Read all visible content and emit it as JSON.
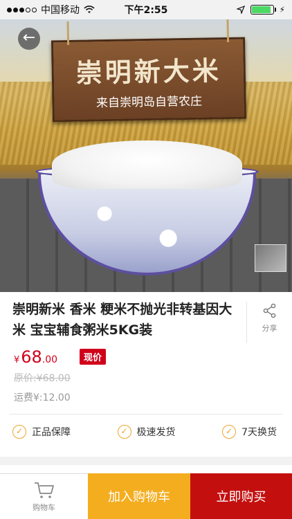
{
  "status_bar": {
    "carrier": "中国移动",
    "time": "下午2:55",
    "battery_level": 0.9,
    "icons": [
      "signal-dots-icon",
      "wifi-icon",
      "location-arrow-icon",
      "battery-icon",
      "charging-icon"
    ]
  },
  "hero": {
    "sign_title": "崇明新大米",
    "sign_subtitle": "来自崇明岛自营农庄"
  },
  "product": {
    "title": "崇明新米 香米 粳米不抛光非转基因大米 宝宝辅食粥米5KG装",
    "price_symbol": "¥",
    "price_int": "68",
    "price_dec": ".00",
    "now_badge": "现价",
    "original_price": "原价:¥68.00",
    "shipping": "运费¥:12.00",
    "share_label": "分享"
  },
  "guarantees": [
    "正品保障",
    "极速发货",
    "7天换货"
  ],
  "bottom_bar": {
    "cart_label": "购物车",
    "add_to_cart": "加入购物车",
    "buy_now": "立即购买"
  },
  "colors": {
    "price_red": "#d0021b",
    "add_cart_orange": "#f4ad1f",
    "buy_now_red": "#c40f0f",
    "check_orange": "#f0a32b"
  }
}
